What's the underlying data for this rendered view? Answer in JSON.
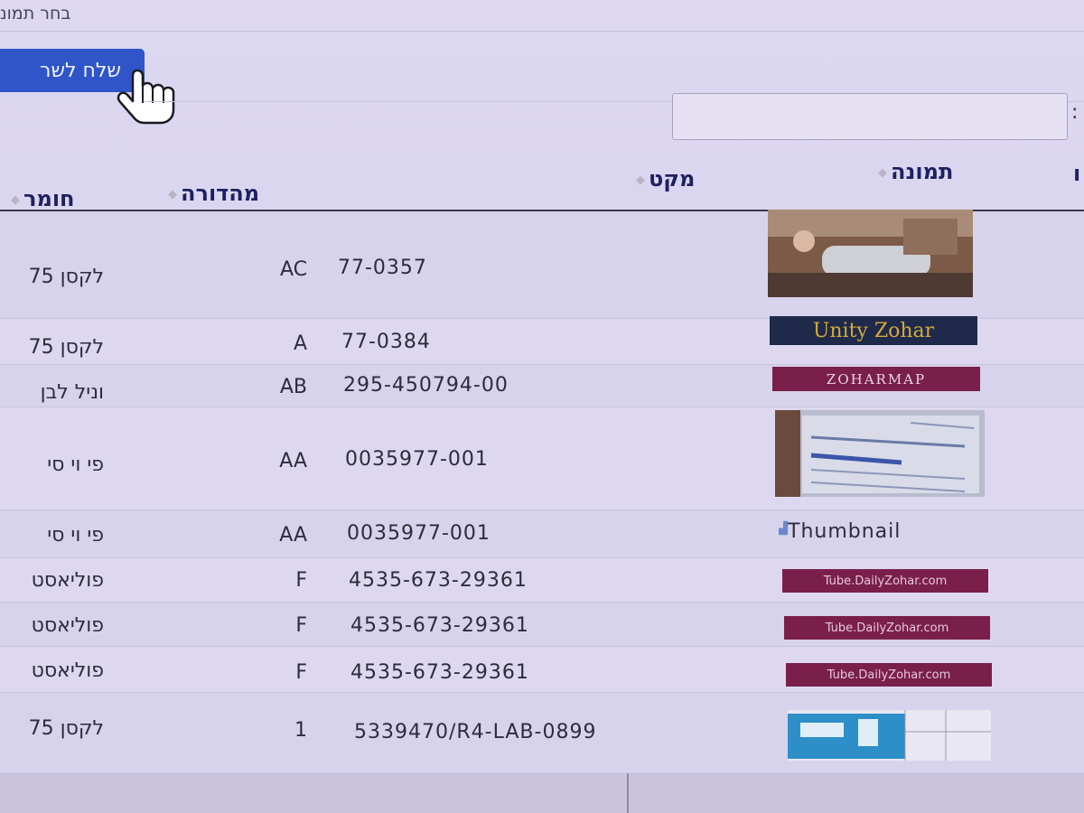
{
  "page": {
    "select_image_label": "בחר תמונ",
    "send_button_label": "שלח לשר",
    "search": {
      "label": ":",
      "value": ""
    }
  },
  "table": {
    "headers": {
      "image": "תמונה",
      "sku": "מקט",
      "edition": "מהדורה",
      "material": "חומר"
    },
    "rows": [
      {
        "thumbnail": "photo",
        "sku": "77-0357",
        "edition": "AC",
        "material": "לקסן 75"
      },
      {
        "thumbnail": "Unity Zohar",
        "sku": "77-0384",
        "edition": "A",
        "material": "לקסן 75"
      },
      {
        "thumbnail": "ZOHARMAP",
        "sku": "295-450794-00",
        "edition": "AB",
        "material": "וניל לבן"
      },
      {
        "thumbnail": "photo",
        "sku": "0035977-001",
        "edition": "AA",
        "material": "פי וי סי"
      },
      {
        "thumbnail": "Thumbnail",
        "sku": "0035977-001",
        "edition": "AA",
        "material": "פי וי סי"
      },
      {
        "thumbnail": "Tube.DailyZohar.com",
        "sku": "4535-673-29361",
        "edition": "F",
        "material": "פוליאסט"
      },
      {
        "thumbnail": "Tube.DailyZohar.com",
        "sku": "4535-673-29361",
        "edition": "F",
        "material": "פוליאסט"
      },
      {
        "thumbnail": "Tube.DailyZohar.com",
        "sku": "4535-673-29361",
        "edition": "F",
        "material": "פוליאסט"
      },
      {
        "thumbnail": "diagram",
        "sku": "5339470/R4-LAB-0899",
        "edition": "1",
        "material": "לקסן 75"
      }
    ]
  },
  "colors": {
    "accent": "#2f55c8",
    "header_text": "#1e2160",
    "banner_maroon": "#7a1f4a",
    "banner_navy": "#1f2a4a"
  }
}
